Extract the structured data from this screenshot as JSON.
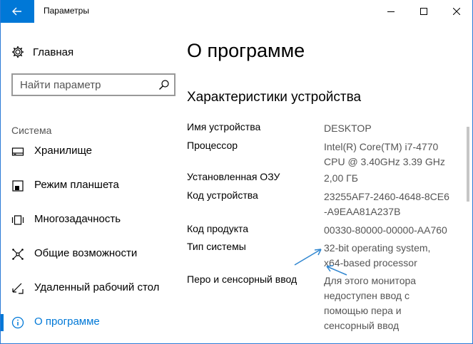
{
  "window": {
    "title": "Параметры",
    "minimize_glyph": "—",
    "maximize_glyph": "☐",
    "close_glyph": "✕"
  },
  "sidebar": {
    "home_label": "Главная",
    "search_placeholder": "Найти параметр",
    "section_label": "Система",
    "items": [
      {
        "label": "Хранилище",
        "icon": "storage-icon"
      },
      {
        "label": "Режим планшета",
        "icon": "tablet-mode-icon"
      },
      {
        "label": "Многозадачность",
        "icon": "multitasking-icon"
      },
      {
        "label": "Общие возможности",
        "icon": "shared-experiences-icon"
      },
      {
        "label": "Удаленный рабочий стол",
        "icon": "remote-desktop-icon"
      },
      {
        "label": "О программе",
        "icon": "info-icon",
        "active": true
      }
    ]
  },
  "main": {
    "title": "О программе",
    "section_title": "Характеристики устройства",
    "specs": [
      {
        "label": "Имя устройства",
        "value": "DESKTOP"
      },
      {
        "label": "Процессор",
        "value": "Intel(R) Core(TM) i7-4770\nCPU @ 3.40GHz   3.39 GHz"
      },
      {
        "label": "Установленная ОЗУ",
        "value": "2,00 ГБ"
      },
      {
        "label": "Код устройства",
        "value": "23255AF7-2460-4648-8CE6\n-A9EAA81A237B"
      },
      {
        "label": "Код продукта",
        "value": "00330-80000-00000-AA760"
      },
      {
        "label": "Тип системы",
        "value": "32-bit operating system,\nx64-based processor"
      },
      {
        "label": "Перо и сенсорный ввод",
        "value": "Для этого монитора\nнедоступен ввод с\nпомощью пера и\nсенсорный ввод"
      }
    ]
  },
  "colors": {
    "accent": "#0078d7",
    "annotation_arrow": "#2f86d0"
  }
}
